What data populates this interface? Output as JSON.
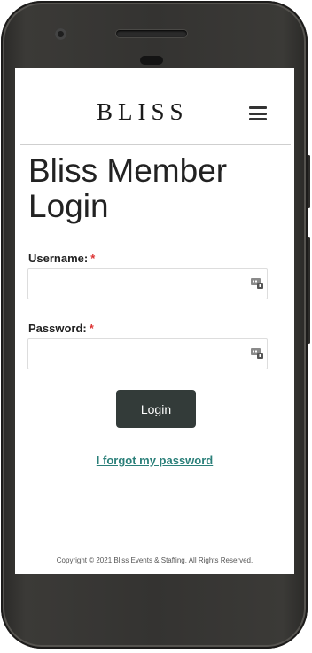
{
  "brand": {
    "logo_text": "BLISS"
  },
  "page": {
    "title": "Bliss Member Login"
  },
  "form": {
    "username_label": "Username:",
    "username_value": "",
    "password_label": "Password:",
    "password_value": "",
    "required_marker": "*",
    "login_label": "Login",
    "forgot_link": "I forgot my password"
  },
  "icons": {
    "menu": "hamburger-menu-icon",
    "field_helper": "password-manager-icon"
  },
  "footer": {
    "copyright": "Copyright © 2021 Bliss Events & Staffing. All Rights Reserved."
  },
  "colors": {
    "button_bg": "#333b39",
    "link": "#2a7f79",
    "required": "#dd3333"
  }
}
